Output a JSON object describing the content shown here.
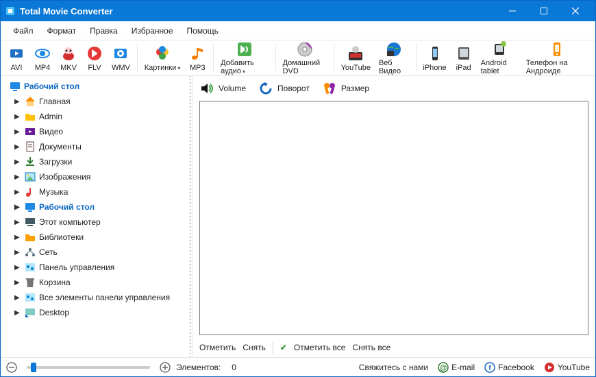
{
  "title": "Total Movie Converter",
  "menu": [
    "Файл",
    "Формат",
    "Правка",
    "Избранное",
    "Помощь"
  ],
  "toolbar": [
    {
      "id": "avi",
      "label": "AVI",
      "color": "#1e6fc4"
    },
    {
      "id": "mp4",
      "label": "MP4",
      "color": "#1e88e5"
    },
    {
      "id": "mkv",
      "label": "MKV",
      "color": "#d32f2f"
    },
    {
      "id": "flv",
      "label": "FLV",
      "color": "#e53935"
    },
    {
      "id": "wmv",
      "label": "WMV",
      "color": "#1e88e5"
    },
    {
      "id": "kartinki",
      "label": "Картинки",
      "color": "#fb8c00",
      "hasDrop": true
    },
    {
      "id": "mp3",
      "label": "MP3",
      "color": "#f57c00"
    },
    {
      "id": "addaudio",
      "label": "Добавить аудио",
      "color": "#4caf50",
      "hasDrop": true
    },
    {
      "id": "dvd",
      "label": "Домашний DVD",
      "color": "#7b1fa2"
    },
    {
      "id": "youtube",
      "label": "YouTube",
      "color": "#d32f2f"
    },
    {
      "id": "webvideo",
      "label": "Веб Видео",
      "color": "#1976d2"
    },
    {
      "id": "iphone",
      "label": "iPhone",
      "color": "#424242"
    },
    {
      "id": "ipad",
      "label": "iPad",
      "color": "#616161"
    },
    {
      "id": "android",
      "label": "Android tablet",
      "color": "#8bc34a"
    },
    {
      "id": "aphone",
      "label": "Телефон на Андроиде",
      "color": "#fb8c00"
    }
  ],
  "toolbar_groups": [
    5,
    2,
    1,
    1,
    2,
    4
  ],
  "tree_root": {
    "label": "Рабочий стол",
    "icon": "desktop",
    "color": "#1e88e5"
  },
  "tree": [
    {
      "label": "Главная",
      "icon": "home",
      "color": "#fb8c00"
    },
    {
      "label": "Admin",
      "icon": "folder",
      "color": "#ffc107"
    },
    {
      "label": "Видео",
      "icon": "video",
      "color": "#6a1b9a"
    },
    {
      "label": "Документы",
      "icon": "docs",
      "color": "#5d4037"
    },
    {
      "label": "Загрузки",
      "icon": "download",
      "color": "#2e7d32"
    },
    {
      "label": "Изображения",
      "icon": "image",
      "color": "#0277bd"
    },
    {
      "label": "Музыка",
      "icon": "music",
      "color": "#e53935"
    },
    {
      "label": "Рабочий стол",
      "icon": "desktop",
      "color": "#1e88e5",
      "selected": true
    },
    {
      "label": "Этот компьютер",
      "icon": "pc",
      "color": "#455a64"
    },
    {
      "label": "Библиотеки",
      "icon": "folder",
      "color": "#ffa000"
    },
    {
      "label": "Сеть",
      "icon": "network",
      "color": "#546e7a"
    },
    {
      "label": "Панель управления",
      "icon": "panel",
      "color": "#0288d1"
    },
    {
      "label": "Корзина",
      "icon": "trash",
      "color": "#757575"
    },
    {
      "label": "Все элементы панели управления",
      "icon": "panel",
      "color": "#0288d1"
    },
    {
      "label": "Desktop",
      "icon": "shortcut",
      "color": "#00897b"
    }
  ],
  "content_tools": [
    {
      "id": "volume",
      "label": "Volume"
    },
    {
      "id": "rotate",
      "label": "Поворот"
    },
    {
      "id": "resize",
      "label": "Размер"
    }
  ],
  "selbar": {
    "mark": "Отметить",
    "unmark": "Снять",
    "markall": "Отметить все",
    "unmarkall": "Снять все"
  },
  "status": {
    "elements_label": "Элементов:",
    "elements_count": "0",
    "contact": "Свяжитесь с нами",
    "email": "E-mail",
    "facebook": "Facebook",
    "youtube": "YouTube"
  }
}
